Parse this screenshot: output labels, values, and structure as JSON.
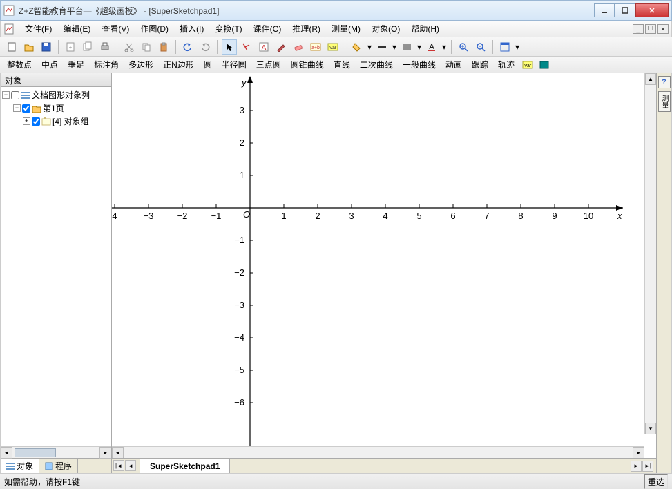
{
  "window": {
    "title": "Z+Z智能教育平台—《超级画板》 - [SuperSketchpad1]"
  },
  "menus": {
    "file": "文件(F)",
    "edit": "编辑(E)",
    "view": "查看(V)",
    "draw": "作图(D)",
    "insert": "插入(I)",
    "transform": "变换(T)",
    "courseware": "课件(C)",
    "reason": "推理(R)",
    "measure": "测量(M)",
    "object": "对象(O)",
    "help": "帮助(H)"
  },
  "toolbar2": {
    "intpoint": "整数点",
    "midpoint": "中点",
    "foot": "垂足",
    "markangle": "标注角",
    "polygon": "多边形",
    "regpoly": "正N边形",
    "circle": "圆",
    "semicircle": "半径圆",
    "threepointcircle": "三点圆",
    "conic": "圆锥曲线",
    "line": "直线",
    "quadratic": "二次曲线",
    "generalcurve": "一般曲线",
    "animation": "动画",
    "trace": "跟踪",
    "locus": "轨迹"
  },
  "sidebar": {
    "title": "对象",
    "root": "文档图形对象列",
    "page": "第1页",
    "group": "[4] 对象组",
    "tabs": {
      "object": "对象",
      "program": "程序"
    }
  },
  "canvas": {
    "tab": "SuperSketchpad1"
  },
  "right": {
    "help": "?",
    "measure": "测量"
  },
  "statusbar": {
    "hint": "如需帮助，请按F1键",
    "right": "重选"
  },
  "chart_data": {
    "type": "scatter",
    "series": [],
    "xlabel": "x",
    "ylabel": "y",
    "origin_label": "O",
    "x_ticks": [
      -4,
      -3,
      -2,
      -1,
      1,
      2,
      3,
      4,
      5,
      6,
      7,
      8,
      9,
      10
    ],
    "x_tick_labels": [
      "4",
      "−3",
      "−2",
      "−1",
      "1",
      "2",
      "3",
      "4",
      "5",
      "6",
      "7",
      "8",
      "9",
      "10"
    ],
    "y_ticks": [
      -6,
      -5,
      -4,
      -3,
      -2,
      -1,
      1,
      2,
      3
    ],
    "y_tick_labels": [
      "−6",
      "−5",
      "−4",
      "−3",
      "−2",
      "−1",
      "1",
      "2",
      "3"
    ],
    "xlim": [
      -4.5,
      10.5
    ],
    "ylim": [
      -6.5,
      4
    ],
    "title": ""
  }
}
